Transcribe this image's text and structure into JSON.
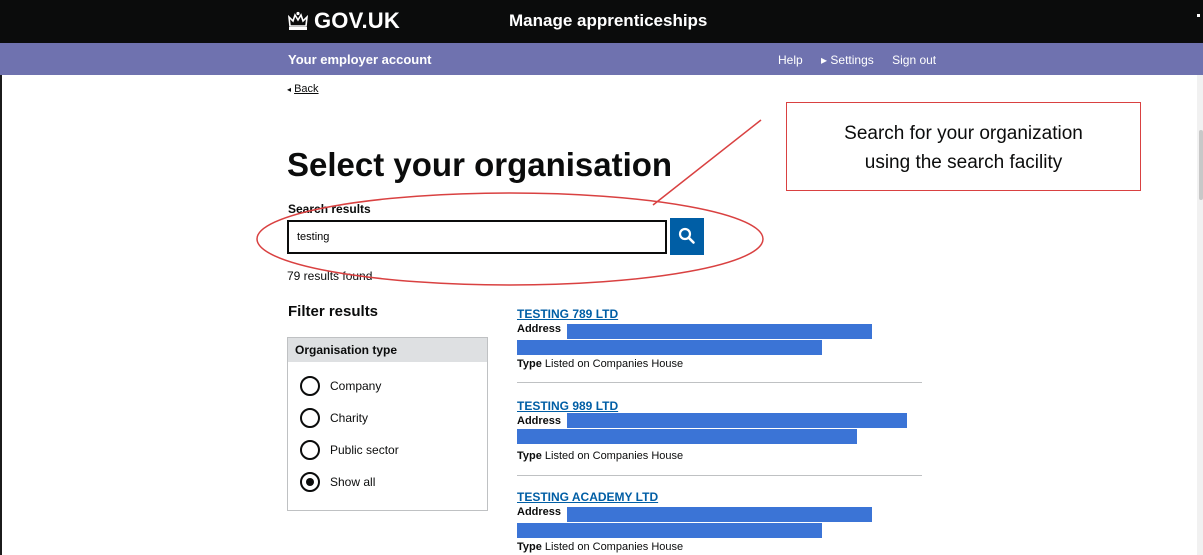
{
  "header": {
    "brand": "GOV.UK",
    "service_name": "Manage apprenticeships"
  },
  "subnav": {
    "account_label": "Your employer account",
    "links": [
      "Help",
      "▸ Settings",
      "Sign out"
    ]
  },
  "back_link": "Back",
  "page_title": "Select your organisation",
  "search": {
    "label": "Search results",
    "value": "testing",
    "results_count": "79 results found"
  },
  "filter": {
    "title": "Filter results",
    "group_title": "Organisation type",
    "options": [
      {
        "label": "Company",
        "checked": false
      },
      {
        "label": "Charity",
        "checked": false
      },
      {
        "label": "Public sector",
        "checked": false
      },
      {
        "label": "Show all",
        "checked": true
      }
    ]
  },
  "results": [
    {
      "name": "TESTING 789 LTD",
      "address_label": "Address",
      "type_label": "Type",
      "type_value": "Listed on Companies House"
    },
    {
      "name": "TESTING 989 LTD",
      "address_label": "Address",
      "type_label": "Type",
      "type_value": "Listed on Companies House"
    },
    {
      "name": "TESTING ACADEMY LTD",
      "address_label": "Address",
      "type_label": "Type",
      "type_value": "Listed on Companies House"
    }
  ],
  "annotation": {
    "callout_line1": "Search for your organization",
    "callout_line2": "using the search facility"
  },
  "colors": {
    "header_bg": "#0b0c0c",
    "subnav_bg": "#6f72af",
    "link_blue": "#005ea5",
    "redaction_blue": "#3b74d6",
    "annotation_red": "#d94141"
  },
  "icons": [
    "crown-icon",
    "search-icon",
    "back-arrow-icon"
  ]
}
